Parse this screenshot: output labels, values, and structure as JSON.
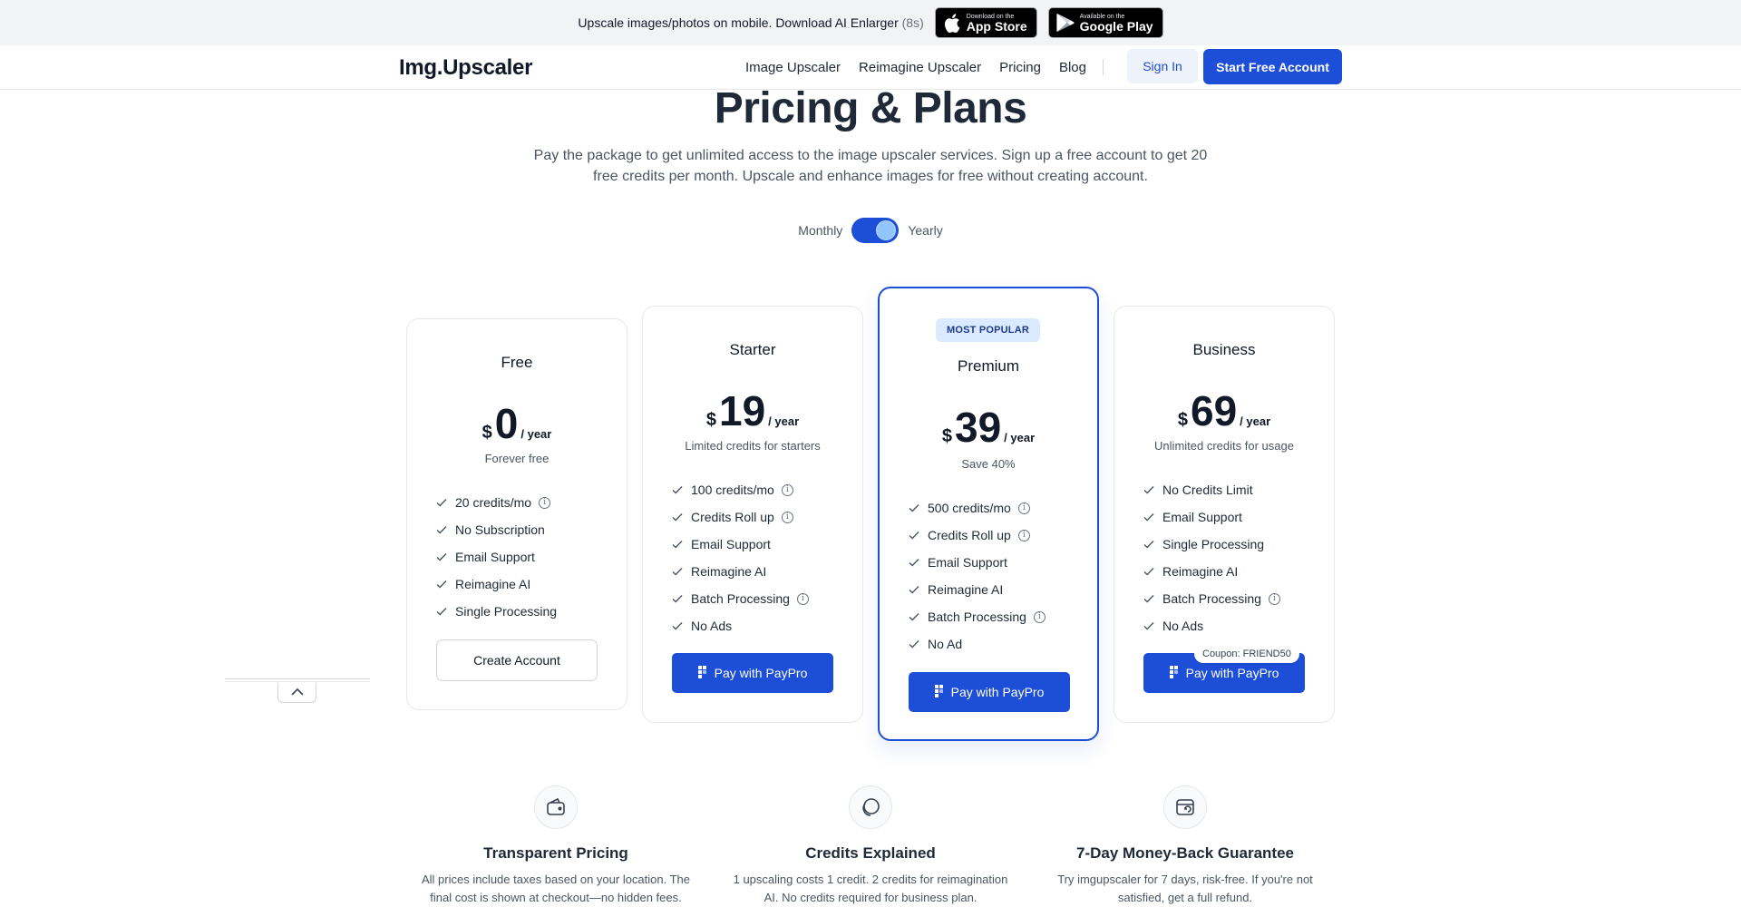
{
  "promo": {
    "text": "Upscale images/photos on mobile. Download AI Enlarger",
    "countdown": "(8s)",
    "app_store": {
      "small": "Download on the",
      "big": "App Store"
    },
    "google_play": {
      "small": "Available on the",
      "big": "Google Play"
    }
  },
  "header": {
    "logo": "Img.Upscaler",
    "nav": [
      "Image Upscaler",
      "Reimagine Upscaler",
      "Pricing",
      "Blog"
    ],
    "sign_in": "Sign In",
    "start": "Start Free Account"
  },
  "hero": {
    "title": "Pricing & Plans",
    "subtitle": "Pay the package to get unlimited access to the image upscaler services. Sign up a free account to get 20 free credits per month. Upscale and enhance images for free without creating account."
  },
  "billing": {
    "monthly": "Monthly",
    "yearly": "Yearly",
    "selected": "Yearly"
  },
  "plans": [
    {
      "name": "Free",
      "currency": "$",
      "price": "0",
      "period": "/ year",
      "note": "Forever free",
      "features": [
        {
          "text": "20 credits/mo",
          "info": true
        },
        {
          "text": "No Subscription",
          "info": false
        },
        {
          "text": "Email Support",
          "info": false
        },
        {
          "text": "Reimagine AI",
          "info": false
        },
        {
          "text": "Single Processing",
          "info": false
        }
      ],
      "button": "Create Account"
    },
    {
      "name": "Starter",
      "currency": "$",
      "price": "19",
      "period": "/ year",
      "note": "Limited credits for starters",
      "features": [
        {
          "text": "100 credits/mo",
          "info": true
        },
        {
          "text": "Credits Roll up",
          "info": true
        },
        {
          "text": "Email Support",
          "info": false
        },
        {
          "text": "Reimagine AI",
          "info": false
        },
        {
          "text": "Batch Processing",
          "info": true
        },
        {
          "text": "No Ads",
          "info": false
        }
      ],
      "button": "Pay with PayPro"
    },
    {
      "name": "Premium",
      "badge": "MOST POPULAR",
      "currency": "$",
      "price": "39",
      "period": "/ year",
      "note": "Save 40%",
      "features": [
        {
          "text": "500 credits/mo",
          "info": true
        },
        {
          "text": "Credits Roll up",
          "info": true
        },
        {
          "text": "Email Support",
          "info": false
        },
        {
          "text": "Reimagine AI",
          "info": false
        },
        {
          "text": "Batch Processing",
          "info": true
        },
        {
          "text": "No Ad",
          "info": false
        }
      ],
      "button": "Pay with PayPro"
    },
    {
      "name": "Business",
      "currency": "$",
      "price": "69",
      "period": "/ year",
      "note": "Unlimited credits for usage",
      "features": [
        {
          "text": "No Credits Limit",
          "info": false
        },
        {
          "text": "Email Support",
          "info": false
        },
        {
          "text": "Single Processing",
          "info": false
        },
        {
          "text": "Reimagine AI",
          "info": false
        },
        {
          "text": "Batch Processing",
          "info": true
        },
        {
          "text": "No Ads",
          "info": false
        }
      ],
      "coupon": "Coupon: FRIEND50",
      "button": "Pay with PayPro"
    }
  ],
  "highlights": [
    {
      "icon": "wallet-icon",
      "title": "Transparent Pricing",
      "text": "All prices include taxes based on your location. The final cost is shown at checkout—no hidden fees."
    },
    {
      "icon": "credits-icon",
      "title": "Credits Explained",
      "text": "1 upscaling costs 1 credit. 2 credits for reimagination AI. No credits required for business plan."
    },
    {
      "icon": "refund-wallet-icon",
      "title": "7-Day Money-Back Guarantee",
      "text": "Try imgupscaler for 7 days, risk-free. If you're not satisfied, get a full refund."
    }
  ],
  "colors": {
    "accent": "#1d4ed8",
    "badge_bg": "#dbeafe",
    "promo_bg": "#f2f3f5"
  }
}
